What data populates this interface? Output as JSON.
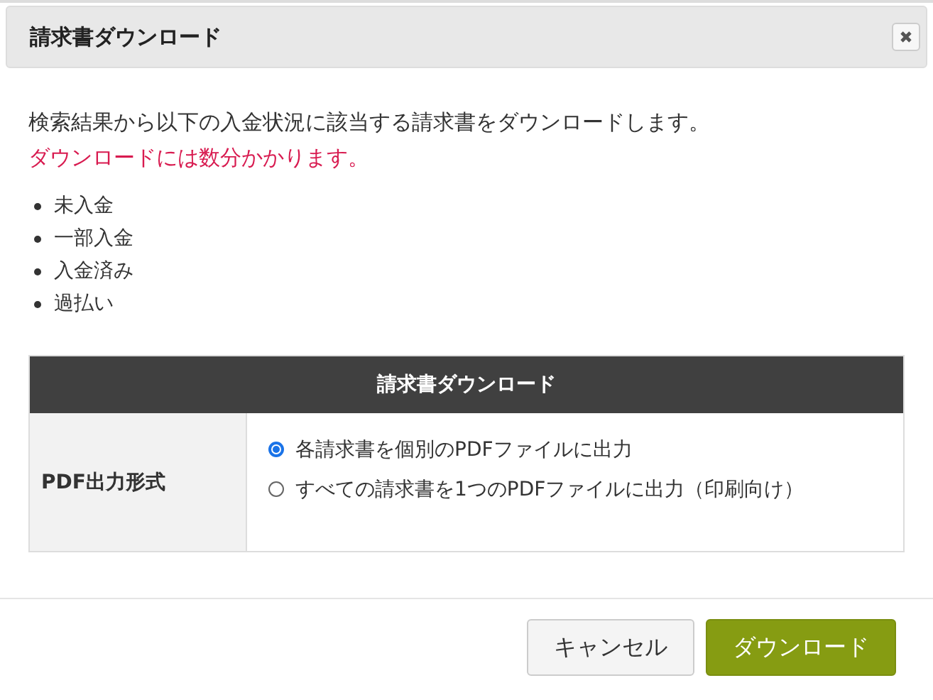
{
  "dialog": {
    "title": "請求書ダウンロード"
  },
  "description": "検索結果から以下の入金状況に該当する請求書をダウンロードします。",
  "warning": "ダウンロードには数分かかります。",
  "statuses": [
    "未入金",
    "一部入金",
    "入金済み",
    "過払い"
  ],
  "table": {
    "heading": "請求書ダウンロード",
    "label": "PDF出力形式",
    "options": [
      {
        "label": "各請求書を個別のPDFファイルに出力",
        "selected": true
      },
      {
        "label": "すべての請求書を1つのPDFファイルに出力（印刷向け）",
        "selected": false
      }
    ]
  },
  "buttons": [
    {
      "label": "キャンセル",
      "kind": "secondary"
    },
    {
      "label": "ダウンロード",
      "kind": "primary"
    }
  ]
}
